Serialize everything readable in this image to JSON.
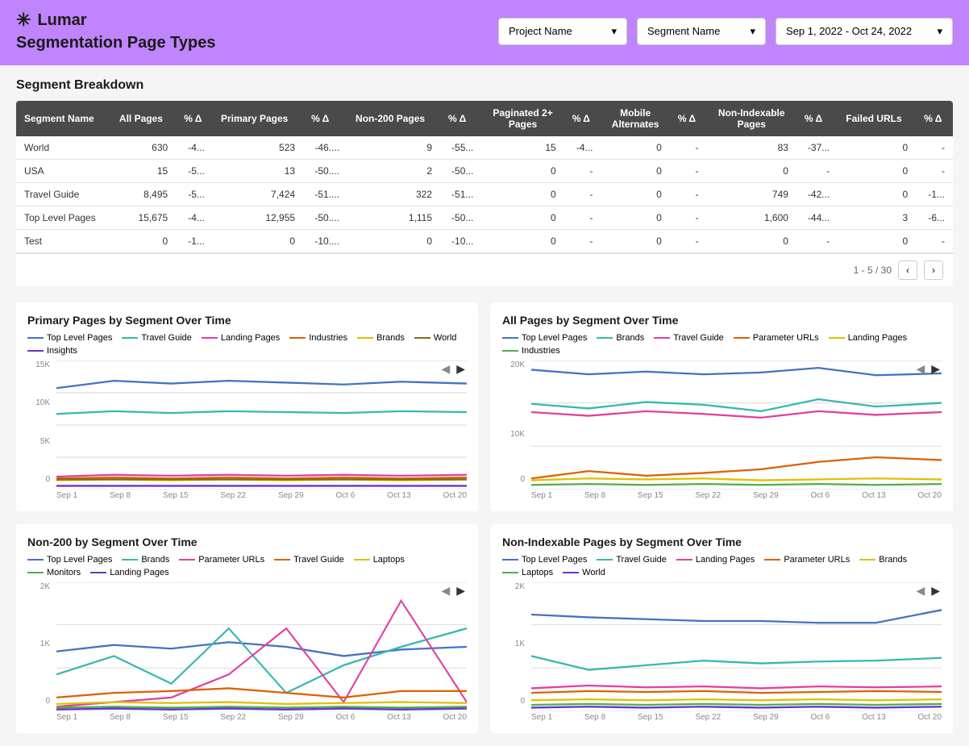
{
  "header": {
    "logo_text": "Lumar",
    "page_title": "Segmentation Page Types",
    "dropdowns": [
      {
        "label": "Project Name",
        "value": "Project Name"
      },
      {
        "label": "Segment Name",
        "value": "Segment Name"
      },
      {
        "label": "Date Range",
        "value": "Sep 1, 2022 - Oct 24, 2022"
      }
    ]
  },
  "segment_breakdown": {
    "title": "Segment Breakdown",
    "columns": [
      "Segment Name",
      "All Pages",
      "% Δ",
      "Primary Pages",
      "% Δ",
      "Non-200 Pages",
      "% Δ",
      "Paginated 2+ Pages",
      "% Δ",
      "Mobile Alternates",
      "% Δ",
      "Non-Indexable Pages",
      "% Δ",
      "Failed URLs",
      "% Δ"
    ],
    "rows": [
      [
        "World",
        "630",
        "-4...",
        "523",
        "-46....",
        "9",
        "-55...",
        "15",
        "-4...",
        "0",
        "-",
        "83",
        "-37...",
        "0",
        "-"
      ],
      [
        "USA",
        "15",
        "-5...",
        "13",
        "-50....",
        "2",
        "-50...",
        "0",
        "-",
        "0",
        "-",
        "0",
        "-",
        "0",
        "-"
      ],
      [
        "Travel Guide",
        "8,495",
        "-5...",
        "7,424",
        "-51....",
        "322",
        "-51...",
        "0",
        "-",
        "0",
        "-",
        "749",
        "-42...",
        "0",
        "-1..."
      ],
      [
        "Top Level Pages",
        "15,675",
        "-4...",
        "12,955",
        "-50....",
        "1,115",
        "-50...",
        "0",
        "-",
        "0",
        "-",
        "1,600",
        "-44...",
        "3",
        "-6..."
      ],
      [
        "Test",
        "0",
        "-1...",
        "0",
        "-10....",
        "0",
        "-10...",
        "0",
        "-",
        "0",
        "-",
        "0",
        "-",
        "0",
        "-"
      ]
    ],
    "pagination": "1 - 5 / 30"
  },
  "charts": {
    "primary_pages": {
      "title": "Primary Pages by Segment Over Time",
      "legend": [
        {
          "label": "Top Level Pages",
          "color": "#4472C4"
        },
        {
          "label": "Travel Guide",
          "color": "#36b8b0"
        },
        {
          "label": "Landing Pages",
          "color": "#e040a0"
        },
        {
          "label": "Industries",
          "color": "#e06000"
        },
        {
          "label": "Brands",
          "color": "#e0c000"
        },
        {
          "label": "World",
          "color": "#8b6914"
        },
        {
          "label": "Insights",
          "color": "#6633cc"
        }
      ],
      "y_labels": [
        "15K",
        "10K",
        "5K",
        "0"
      ],
      "x_labels": [
        "Sep 1",
        "Sep 8",
        "Sep 15",
        "Sep 22",
        "Sep 29",
        "Oct 6",
        "Oct 13",
        "Oct 20"
      ]
    },
    "all_pages": {
      "title": "All Pages by Segment Over Time",
      "legend": [
        {
          "label": "Top Level Pages",
          "color": "#4472C4"
        },
        {
          "label": "Brands",
          "color": "#36b8b0"
        },
        {
          "label": "Travel Guide",
          "color": "#e040a0"
        },
        {
          "label": "Parameter URLs",
          "color": "#e06000"
        },
        {
          "label": "Landing Pages",
          "color": "#e0c000"
        },
        {
          "label": "Industries",
          "color": "#4caf50"
        }
      ],
      "y_labels": [
        "20K",
        "10K",
        "0"
      ],
      "x_labels": [
        "Sep 1",
        "Sep 8",
        "Sep 15",
        "Sep 22",
        "Sep 29",
        "Oct 6",
        "Oct 13",
        "Oct 20"
      ]
    },
    "non200": {
      "title": "Non-200 by Segment Over Time",
      "legend": [
        {
          "label": "Top Level Pages",
          "color": "#4472C4"
        },
        {
          "label": "Brands",
          "color": "#36b8b0"
        },
        {
          "label": "Parameter URLs",
          "color": "#e040a0"
        },
        {
          "label": "Travel Guide",
          "color": "#e06000"
        },
        {
          "label": "Laptops",
          "color": "#e0c000"
        },
        {
          "label": "Monitors",
          "color": "#4caf50"
        },
        {
          "label": "Landing Pages",
          "color": "#6633cc"
        }
      ],
      "y_labels": [
        "2K",
        "1K",
        "0"
      ],
      "x_labels": [
        "Sep 1",
        "Sep 8",
        "Sep 15",
        "Sep 22",
        "Sep 29",
        "Oct 6",
        "Oct 13",
        "Oct 20"
      ]
    },
    "non_indexable": {
      "title": "Non-Indexable Pages by Segment Over Time",
      "legend": [
        {
          "label": "Top Level Pages",
          "color": "#4472C4"
        },
        {
          "label": "Travel Guide",
          "color": "#36b8b0"
        },
        {
          "label": "Landing Pages",
          "color": "#e040a0"
        },
        {
          "label": "Parameter URLs",
          "color": "#e06000"
        },
        {
          "label": "Brands",
          "color": "#e0c000"
        },
        {
          "label": "Laptops",
          "color": "#4caf50"
        },
        {
          "label": "World",
          "color": "#6633cc"
        }
      ],
      "y_labels": [
        "2K",
        "1K",
        "0"
      ],
      "x_labels": [
        "Sep 1",
        "Sep 8",
        "Sep 15",
        "Sep 22",
        "Sep 29",
        "Oct 6",
        "Oct 13",
        "Oct 20"
      ]
    }
  }
}
